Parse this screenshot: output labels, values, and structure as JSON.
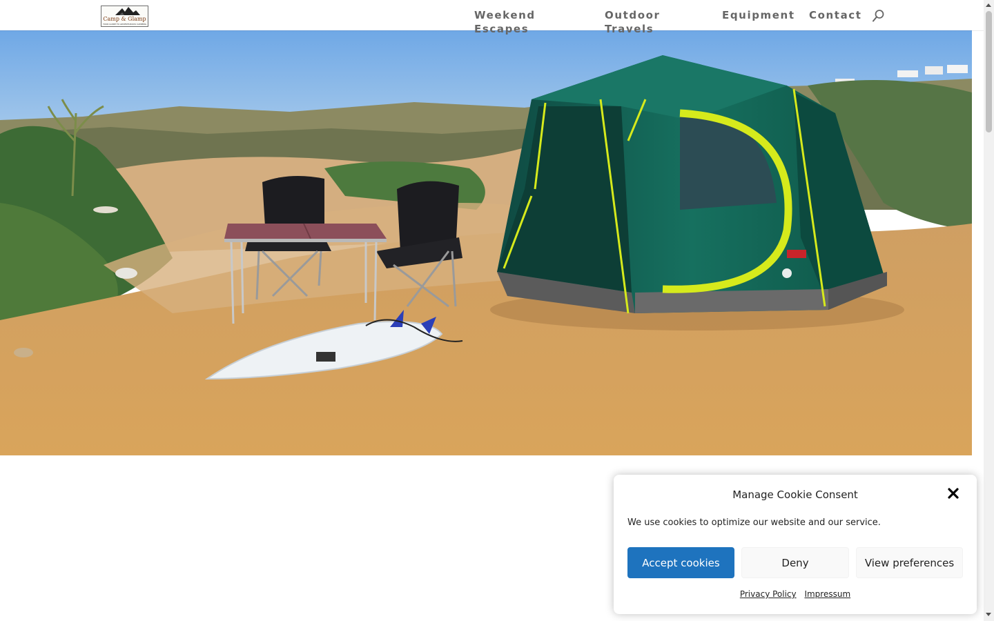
{
  "header": {
    "logo": {
      "title": "Camp & Glamp",
      "subtitle": "YOUR GUIDE TO ADVENTUROUS CAMPING & GLAMPING"
    },
    "nav": [
      {
        "label": "Weekend Escapes"
      },
      {
        "label": "Outdoor Travels"
      },
      {
        "label": "Equipment"
      },
      {
        "label": "Contact"
      }
    ],
    "search_icon": "search-icon"
  },
  "hero": {
    "image": "camping-scene-tent-chairs-table-surfboard",
    "colors": {
      "sky": "#7fb2e8",
      "sand": "#d7a35e",
      "tent": "#136b5c",
      "accent": "#d8ec1c"
    }
  },
  "cookie_banner": {
    "title": "Manage Cookie Consent",
    "message": "We use cookies to optimize our website and our service.",
    "accept_label": "Accept cookies",
    "deny_label": "Deny",
    "preferences_label": "View preferences",
    "links": [
      {
        "label": "Privacy Policy"
      },
      {
        "label": "Impressum"
      }
    ],
    "close_icon": "close-icon",
    "colors": {
      "accept": "#1e73be",
      "neutral": "#f9f9f9"
    }
  }
}
